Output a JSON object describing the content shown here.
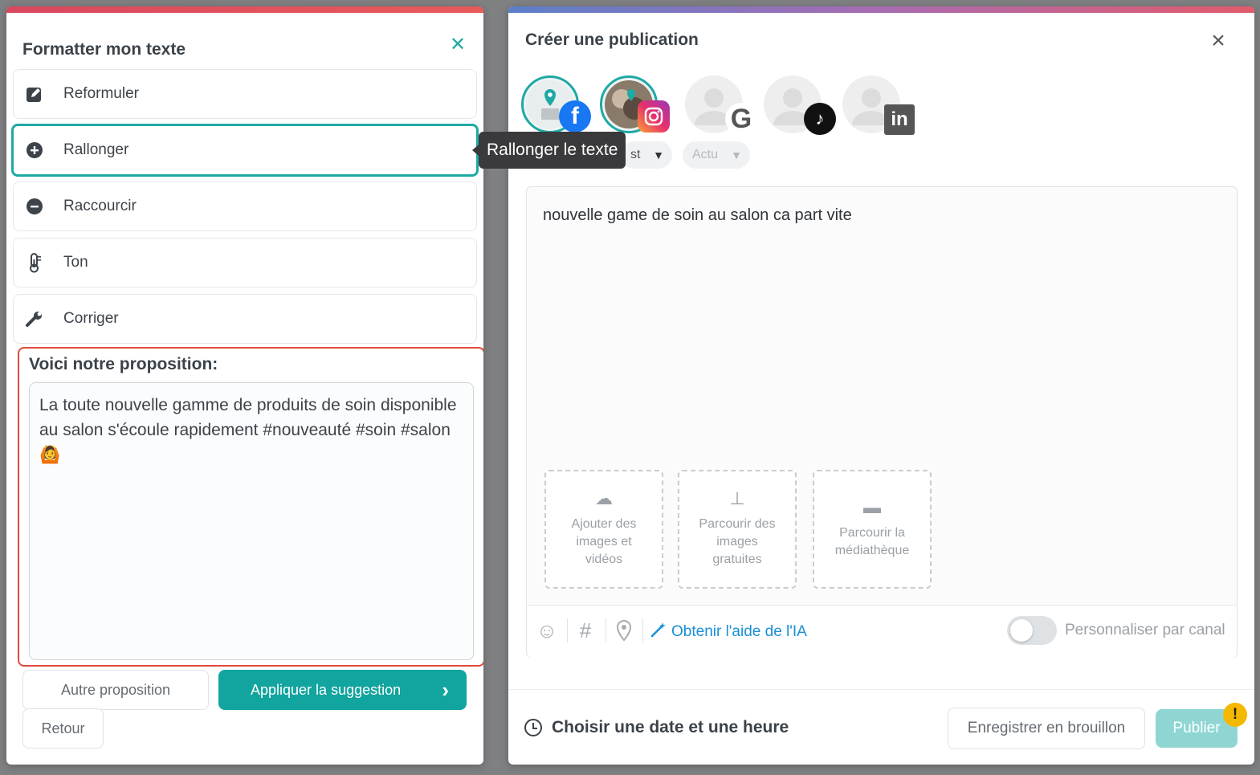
{
  "formatter": {
    "title": "Formatter mon texte",
    "close_icon": "close-icon",
    "items": [
      {
        "label": "Reformuler",
        "icon": "pencil-square-icon"
      },
      {
        "label": "Rallonger",
        "icon": "plus-circle-icon"
      },
      {
        "label": "Raccourcir",
        "icon": "minus-circle-icon"
      },
      {
        "label": "Ton",
        "icon": "thermometer-icon"
      },
      {
        "label": "Corriger",
        "icon": "wrench-icon"
      }
    ],
    "active_item": "Rallonger",
    "proposal_title": "Voici notre proposition:",
    "proposal_text": "La toute nouvelle gamme de produits de soin disponible au salon s'écoule rapidement #nouveauté #soin #salon 🙆",
    "other_button": "Autre proposition",
    "apply_button": "Appliquer la suggestion",
    "back_button": "Retour"
  },
  "tooltip": {
    "text": "Rallonger le texte"
  },
  "publication": {
    "title": "Créer une publication",
    "close_icon": "close-icon",
    "channels": [
      {
        "network": "facebook",
        "selected": true
      },
      {
        "network": "instagram",
        "selected": true
      },
      {
        "network": "google",
        "selected": false
      },
      {
        "network": "tiktok",
        "selected": false
      },
      {
        "network": "linkedin",
        "selected": false
      }
    ],
    "pills": [
      {
        "label": "st"
      },
      {
        "label": "Actu"
      }
    ],
    "editor_text": "nouvelle game de soin au salon ca part vite",
    "media": [
      {
        "label": "Ajouter des images et vidéos",
        "icon": "cloud-upload-icon"
      },
      {
        "label": "Parcourir des images gratuites",
        "icon": "image-library-icon"
      },
      {
        "label": "Parcourir la médiathèque",
        "icon": "folder-icon"
      }
    ],
    "ai_help": "Obtenir l'aide de l'IA",
    "personalize_label": "Personnaliser par canal",
    "personalize_on": false,
    "schedule_label": "Choisir une date et une heure",
    "draft_button": "Enregistrer en brouillon",
    "publish_button": "Publier",
    "warning_badge": "!"
  },
  "colors": {
    "accent": "#12a49e",
    "proposal_border": "#e0483b",
    "link": "#1a8fd6",
    "publish_disabled": "#8fd6d3"
  }
}
